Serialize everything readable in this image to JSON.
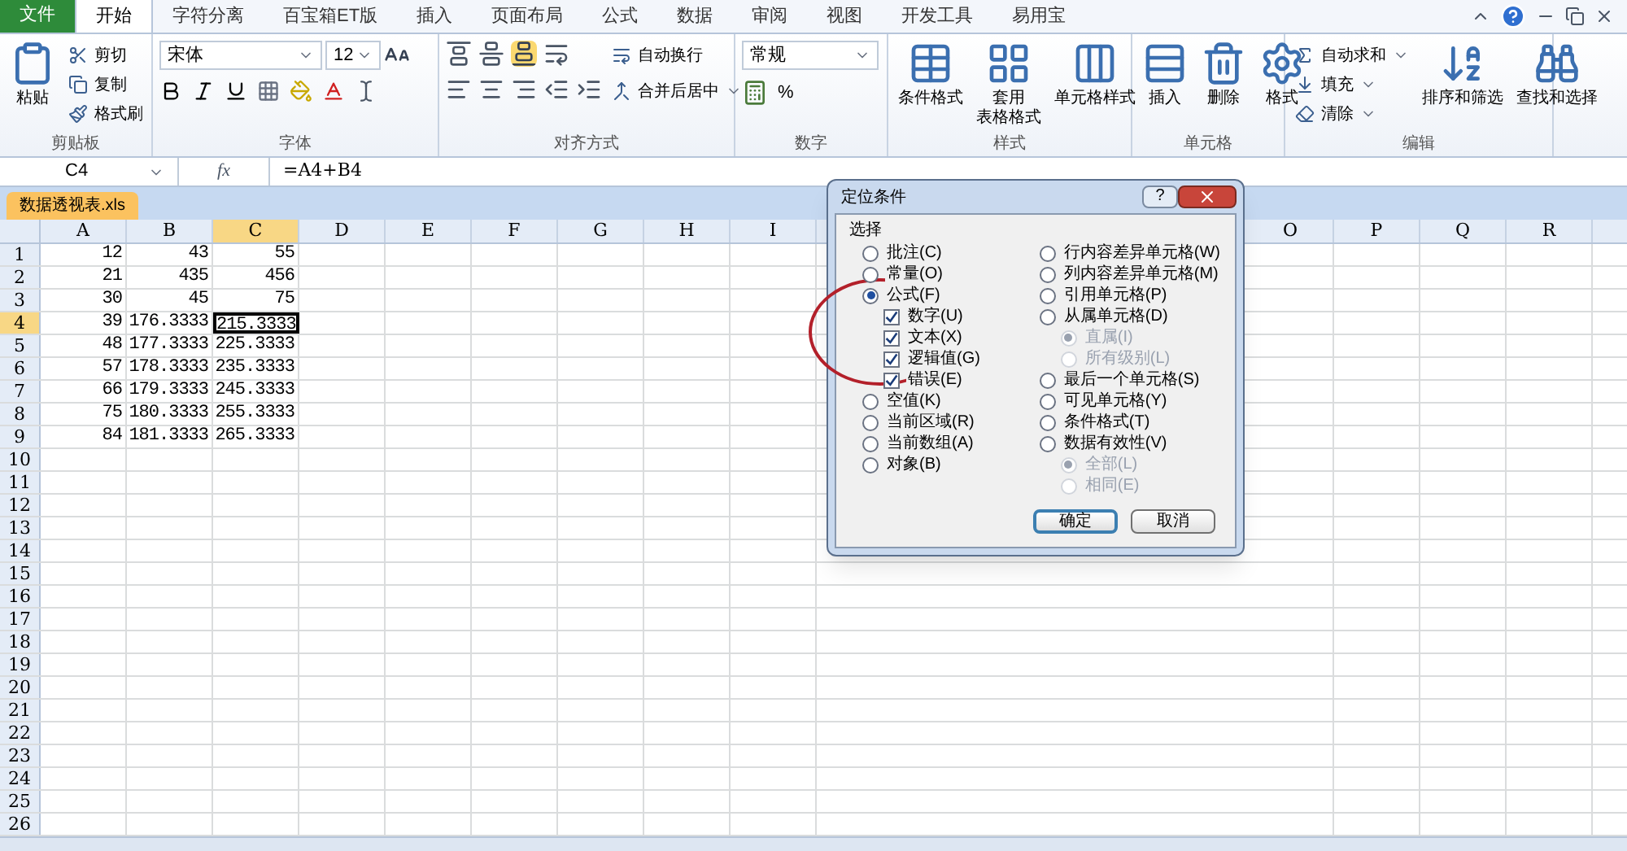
{
  "ribbon_tabs": [
    {
      "label": "文件",
      "kind": "file",
      "selected": false
    },
    {
      "label": "开始",
      "kind": "tab",
      "selected": true
    },
    {
      "label": "字符分离",
      "kind": "tab",
      "selected": false
    },
    {
      "label": "百宝箱ET版",
      "kind": "tab",
      "selected": false
    },
    {
      "label": "插入",
      "kind": "tab",
      "selected": false
    },
    {
      "label": "页面布局",
      "kind": "tab",
      "selected": false
    },
    {
      "label": "公式",
      "kind": "tab",
      "selected": false
    },
    {
      "label": "数据",
      "kind": "tab",
      "selected": false
    },
    {
      "label": "审阅",
      "kind": "tab",
      "selected": false
    },
    {
      "label": "视图",
      "kind": "tab",
      "selected": false
    },
    {
      "label": "开发工具",
      "kind": "tab",
      "selected": false
    },
    {
      "label": "易用宝",
      "kind": "tab",
      "selected": false
    }
  ],
  "ribbon": {
    "clipboard": {
      "label": "剪贴板",
      "paste": "粘贴",
      "cut": "剪切",
      "copy": "复制",
      "format_painter": "格式刷"
    },
    "font": {
      "label": "字体",
      "family": "宋体",
      "size": "12"
    },
    "alignment": {
      "label": "对齐方式",
      "wrap_text": "自动换行",
      "merge_center": "合并后居中"
    },
    "number": {
      "label": "数字",
      "format": "常规",
      "percent": "%"
    },
    "styles": {
      "label": "样式",
      "items": [
        [
          "条件格式"
        ],
        [
          "套用",
          "表格格式"
        ],
        [
          "单元格样式"
        ]
      ]
    },
    "cells": {
      "label": "单元格",
      "items": [
        "插入",
        "删除",
        "格式"
      ]
    },
    "editing": {
      "label": "编辑",
      "small_items": [
        "自动求和",
        "填充",
        "清除"
      ],
      "large_items": [
        "排序和筛选",
        "查找和选择"
      ]
    }
  },
  "formula_bar": {
    "name_box": "C4",
    "function_label": "fx",
    "formula": "=A4+B4"
  },
  "workbook_tab": "数据透视表.xls",
  "sheet": {
    "columns": [
      {
        "label": "A",
        "selected": false
      },
      {
        "label": "B",
        "selected": false
      },
      {
        "label": "C",
        "selected": true
      },
      {
        "label": "D",
        "selected": false
      },
      {
        "label": "E",
        "selected": false
      },
      {
        "label": "F",
        "selected": false
      },
      {
        "label": "G",
        "selected": false
      },
      {
        "label": "H",
        "selected": false
      },
      {
        "label": "I",
        "selected": false
      }
    ],
    "columns_right": [
      {
        "label": "O",
        "selected": false
      },
      {
        "label": "P",
        "selected": false
      },
      {
        "label": "Q",
        "selected": false
      },
      {
        "label": "R",
        "selected": false
      }
    ],
    "rows": [
      {
        "label": "1",
        "selected": false,
        "cells": [
          {
            "value": "12",
            "active": false
          },
          {
            "value": "43",
            "active": false
          },
          {
            "value": "55",
            "active": false
          }
        ]
      },
      {
        "label": "2",
        "selected": false,
        "cells": [
          {
            "value": "21",
            "active": false
          },
          {
            "value": "435",
            "active": false
          },
          {
            "value": "456",
            "active": false
          }
        ]
      },
      {
        "label": "3",
        "selected": false,
        "cells": [
          {
            "value": "30",
            "active": false
          },
          {
            "value": "45",
            "active": false
          },
          {
            "value": "75",
            "active": false
          }
        ]
      },
      {
        "label": "4",
        "selected": true,
        "cells": [
          {
            "value": "39",
            "active": false
          },
          {
            "value": "176.3333",
            "active": false
          },
          {
            "value": "215.3333",
            "active": true
          }
        ]
      },
      {
        "label": "5",
        "selected": false,
        "cells": [
          {
            "value": "48",
            "active": false
          },
          {
            "value": "177.3333",
            "active": false
          },
          {
            "value": "225.3333",
            "active": false
          }
        ]
      },
      {
        "label": "6",
        "selected": false,
        "cells": [
          {
            "value": "57",
            "active": false
          },
          {
            "value": "178.3333",
            "active": false
          },
          {
            "value": "235.3333",
            "active": false
          }
        ]
      },
      {
        "label": "7",
        "selected": false,
        "cells": [
          {
            "value": "66",
            "active": false
          },
          {
            "value": "179.3333",
            "active": false
          },
          {
            "value": "245.3333",
            "active": false
          }
        ]
      },
      {
        "label": "8",
        "selected": false,
        "cells": [
          {
            "value": "75",
            "active": false
          },
          {
            "value": "180.3333",
            "active": false
          },
          {
            "value": "255.3333",
            "active": false
          }
        ]
      },
      {
        "label": "9",
        "selected": false,
        "cells": [
          {
            "value": "84",
            "active": false
          },
          {
            "value": "181.3333",
            "active": false
          },
          {
            "value": "265.3333",
            "active": false
          }
        ]
      },
      {
        "label": "10",
        "selected": false
      },
      {
        "label": "11",
        "selected": false
      },
      {
        "label": "12",
        "selected": false
      },
      {
        "label": "13",
        "selected": false
      },
      {
        "label": "14",
        "selected": false
      },
      {
        "label": "15",
        "selected": false
      },
      {
        "label": "16",
        "selected": false
      },
      {
        "label": "17",
        "selected": false
      },
      {
        "label": "18",
        "selected": false
      },
      {
        "label": "19",
        "selected": false
      },
      {
        "label": "20",
        "selected": false
      },
      {
        "label": "21",
        "selected": false
      },
      {
        "label": "22",
        "selected": false
      },
      {
        "label": "23",
        "selected": false
      },
      {
        "label": "24",
        "selected": false
      },
      {
        "label": "25",
        "selected": false
      },
      {
        "label": "26",
        "selected": false
      }
    ]
  },
  "dialog": {
    "title": "定位条件",
    "help": "?",
    "group_label": "选择",
    "left": [
      {
        "kind": "radio",
        "label": "批注(C)",
        "selected": false
      },
      {
        "kind": "radio",
        "label": "常量(O)",
        "selected": false
      },
      {
        "kind": "radio",
        "label": "公式(F)",
        "selected": true,
        "children": [
          {
            "kind": "checkbox",
            "label": "数字(U)",
            "checked": true
          },
          {
            "kind": "checkbox",
            "label": "文本(X)",
            "checked": true
          },
          {
            "kind": "checkbox",
            "label": "逻辑值(G)",
            "checked": true
          },
          {
            "kind": "checkbox",
            "label": "错误(E)",
            "checked": true
          }
        ]
      },
      {
        "kind": "radio",
        "label": "空值(K)",
        "selected": false
      },
      {
        "kind": "radio",
        "label": "当前区域(R)",
        "selected": false
      },
      {
        "kind": "radio",
        "label": "当前数组(A)",
        "selected": false
      },
      {
        "kind": "radio",
        "label": "对象(B)",
        "selected": false
      }
    ],
    "right": [
      {
        "kind": "radio",
        "label": "行内容差异单元格(W)",
        "selected": false
      },
      {
        "kind": "radio",
        "label": "列内容差异单元格(M)",
        "selected": false
      },
      {
        "kind": "radio",
        "label": "引用单元格(P)",
        "selected": false
      },
      {
        "kind": "radio",
        "label": "从属单元格(D)",
        "selected": false,
        "children": [
          {
            "kind": "radio",
            "label": "直属(I)",
            "selected": true,
            "disabled": true
          },
          {
            "kind": "radio",
            "label": "所有级别(L)",
            "selected": false,
            "disabled": true
          }
        ]
      },
      {
        "kind": "radio",
        "label": "最后一个单元格(S)",
        "selected": false
      },
      {
        "kind": "radio",
        "label": "可见单元格(Y)",
        "selected": false
      },
      {
        "kind": "radio",
        "label": "条件格式(T)",
        "selected": false
      },
      {
        "kind": "radio",
        "label": "数据有效性(V)",
        "selected": false,
        "children": [
          {
            "kind": "radio",
            "label": "全部(L)",
            "selected": true,
            "disabled": true
          },
          {
            "kind": "radio",
            "label": "相同(E)",
            "selected": false,
            "disabled": true
          }
        ]
      }
    ],
    "buttons": [
      {
        "label": "确定",
        "default": true
      },
      {
        "label": "取消",
        "default": false
      }
    ]
  }
}
